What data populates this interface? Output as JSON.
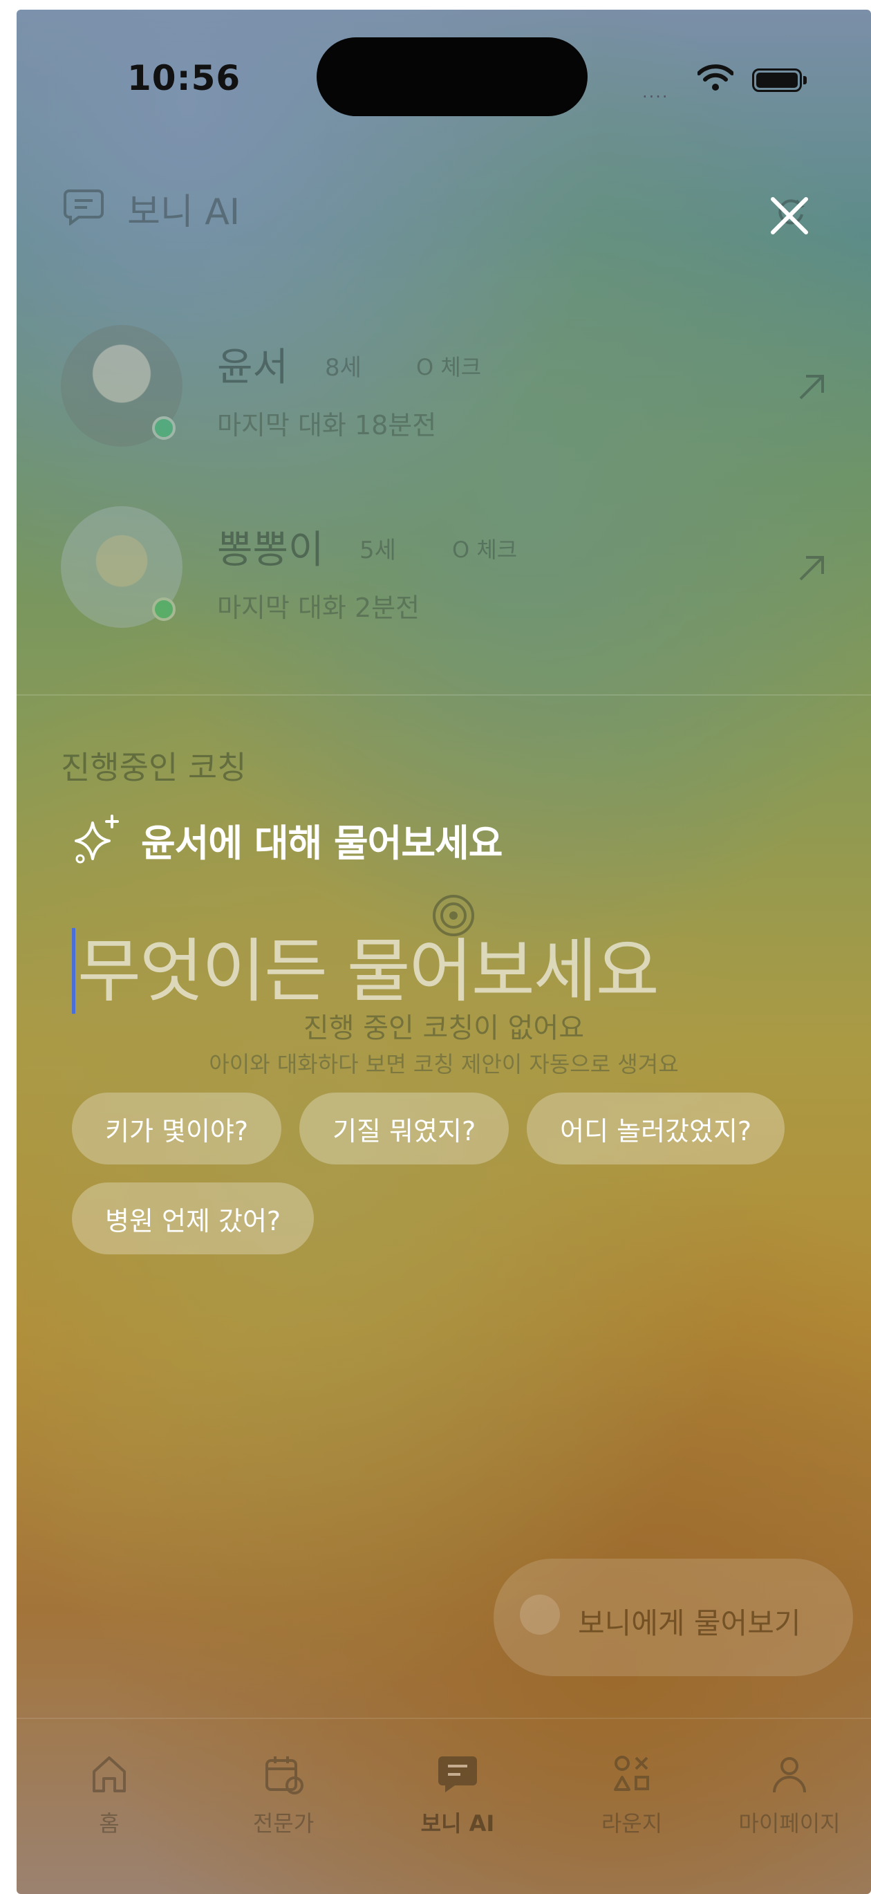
{
  "status_bar": {
    "time": "10:56",
    "signal": "...."
  },
  "header": {
    "title": "보니 AI"
  },
  "children": [
    {
      "name": "윤서",
      "age": "8세",
      "tag": "O 체크",
      "last_chat": "마지막 대화 18분전"
    },
    {
      "name": "뽕뽕이",
      "age": "5세",
      "tag": "O 체크",
      "last_chat": "마지막 대화 2분전"
    }
  ],
  "coaching": {
    "section_title": "진행중인 코칭",
    "empty_title": "진행 중인 코칭이 없어요",
    "empty_subtitle": "아이와 대화하다 보면 코칭 제안이 자동으로 생겨요"
  },
  "fab": {
    "label": "보니에게 물어보기"
  },
  "tabs": [
    {
      "label": "홈",
      "icon": "home-icon"
    },
    {
      "label": "전문가",
      "icon": "calendar-icon"
    },
    {
      "label": "보니 AI",
      "icon": "chat-icon",
      "active": true
    },
    {
      "label": "라운지",
      "icon": "shapes-icon"
    },
    {
      "label": "마이페이지",
      "icon": "person-icon"
    }
  ],
  "overlay": {
    "title": "윤서에 대해 물어보세요",
    "input_placeholder": "무엇이든 물어보세요",
    "input_value": "",
    "suggestions": [
      "키가 몇이야?",
      "기질 뭐였지?",
      "어디 놀러갔었지?",
      "병원 언제 갔어?"
    ]
  },
  "colors": {
    "caret": "#4a6fd8",
    "online": "#2ecc71"
  }
}
